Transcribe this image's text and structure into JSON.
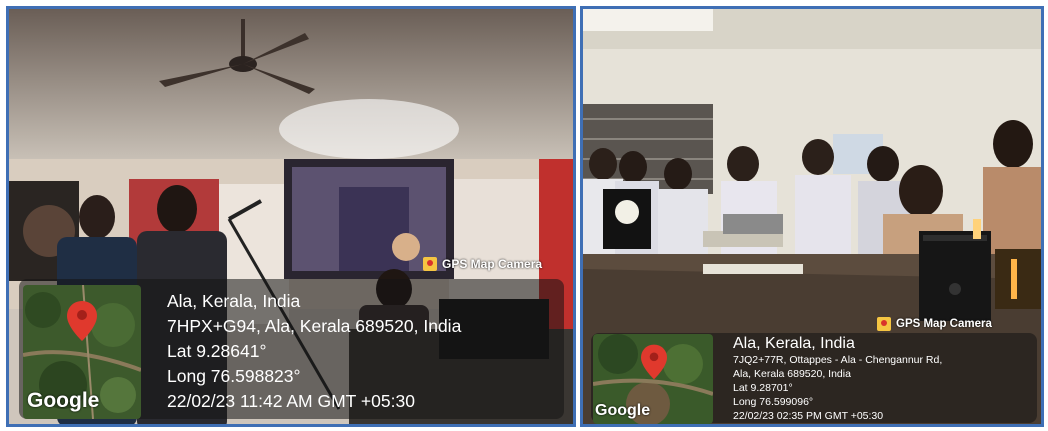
{
  "left": {
    "watermark": "GPS Map Camera",
    "map_label": "Google",
    "lines": [
      "Ala, Kerala, India",
      "7HPX+G94, Ala, Kerala 689520, India",
      "Lat 9.28641°",
      "Long 76.598823°",
      "22/02/23 11:42 AM GMT +05:30"
    ]
  },
  "right": {
    "watermark": "GPS Map Camera",
    "map_label": "Google",
    "lines": [
      "Ala, Kerala, India",
      "7JQ2+77R, Ottappes - Ala - Chengannur Rd,",
      "Ala, Kerala 689520, India",
      "Lat 9.28701°",
      "Long 76.599096°",
      "22/02/23 02:35 PM GMT +05:30"
    ]
  },
  "colors": {
    "frame": "#3f6fb5",
    "pin": "#e0392d",
    "overlay": "rgba(20,20,20,0.55)"
  },
  "icons": {
    "pin": "map-pin-icon",
    "camera": "gps-camera-icon"
  }
}
